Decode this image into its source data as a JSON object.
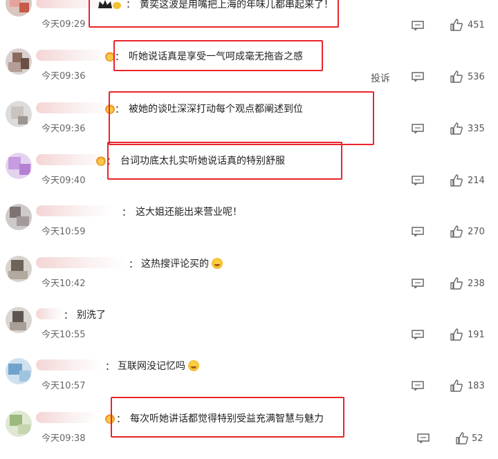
{
  "comments": [
    {
      "text": "黄奕这波是用嘴把上海的年味儿都串起来了！",
      "time": "今天09:29",
      "likes": "451"
    },
    {
      "text": "听她说话真是享受一气呵成毫无拖沓之感",
      "time": "今天09:36",
      "likes": "536",
      "report": "投诉"
    },
    {
      "text": "被她的谈吐深深打动每个观点都阐述到位",
      "time": "今天09:36",
      "likes": "335"
    },
    {
      "text": "台词功底太扎实听她说话真的特别舒服",
      "time": "今天09:40",
      "likes": "214"
    },
    {
      "text": "这大姐还能出来营业呢！",
      "time": "今天10:59",
      "likes": "270"
    },
    {
      "text": "这热搜评论买的",
      "time": "今天10:42",
      "likes": "238",
      "emoji": "laugh-cry-emoji"
    },
    {
      "text": "别洗了",
      "time": "今天10:55",
      "likes": "191"
    },
    {
      "text": "互联网没记忆吗",
      "time": "今天10:57",
      "likes": "183",
      "emoji": "smirk-emoji"
    },
    {
      "text": "每次听她讲话都觉得特别受益充满智慧与魅力",
      "time": "今天09:38",
      "likes": "52"
    }
  ],
  "colon": "：",
  "colors": {
    "highlight_box": "#e8242a",
    "time_text": "#666666",
    "badge": "#f7c948"
  },
  "icons": {
    "reply": "comment-icon",
    "like": "thumbs-up-icon",
    "badge": "crown-badge-icon"
  }
}
